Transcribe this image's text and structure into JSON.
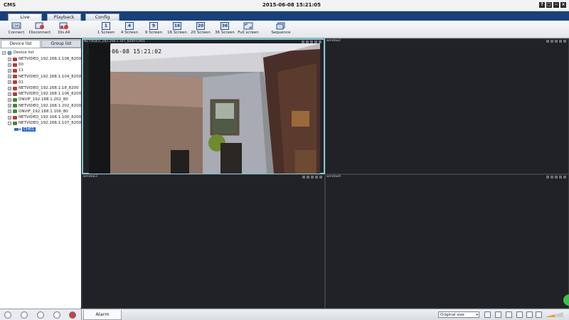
{
  "app": {
    "title": "CMS",
    "datetime": "2015-06-08 15:21:05"
  },
  "window_controls": [
    "?",
    "□",
    "−",
    "×"
  ],
  "main_tabs": [
    "Live",
    "Playback",
    "Config"
  ],
  "toolbar": [
    {
      "label": "Connect",
      "icon": "connect-icon"
    },
    {
      "label": "Disconnect",
      "icon": "disconnect-icon"
    },
    {
      "label": "Dis.All",
      "icon": "disconnect-all-icon"
    },
    {
      "label": "1 Screen",
      "num": "1"
    },
    {
      "label": "4 Screen",
      "num": "4"
    },
    {
      "label": "9 Screen",
      "num": "9"
    },
    {
      "label": "16 Screen",
      "num": "16"
    },
    {
      "label": "20 Screen",
      "num": "20"
    },
    {
      "label": "36 Screen",
      "num": "36"
    },
    {
      "label": "Full screen",
      "icon": "fullscreen-icon"
    },
    {
      "label": "Sequence",
      "icon": "sequence-icon"
    }
  ],
  "left_tabs": [
    "Device list",
    "Group list"
  ],
  "tree": {
    "root": "Device list",
    "devices": [
      {
        "name": "NETVIDEO_192.168.1.108_8200",
        "color": "#b33a3a"
      },
      {
        "name": "00",
        "color": "#b33a3a"
      },
      {
        "name": "11",
        "color": "#b33a3a"
      },
      {
        "name": "NETVIDEO_192.168.1.104_8200",
        "color": "#b33a3a"
      },
      {
        "name": "01",
        "color": "#b33a3a"
      },
      {
        "name": "NETVIDEO_192.168.1.18_8200",
        "color": "#b33a3a"
      },
      {
        "name": "NETVIDEO_192.168.1.106_8200",
        "color": "#b33a3a"
      },
      {
        "name": "ONVIF_192.168.1.202_80",
        "color": "#3a8a3a"
      },
      {
        "name": "NETVIDEO_192.168.1.202_8200",
        "color": "#3a8a3a"
      },
      {
        "name": "ONVIF_192.168.1.106_80",
        "color": "#3a8a3a"
      },
      {
        "name": "NETVIDEO_192.168.1.100_8200",
        "color": "#b33a3a"
      },
      {
        "name": "NETVIDEO_192.168.1.107_8200",
        "color": "#3a8a3a"
      }
    ],
    "selected_channel": "CH01"
  },
  "panes": [
    {
      "title": "NETVIDEO_192.168.1.107_8200-CH01",
      "active": true
    },
    {
      "title": "window2",
      "active": false
    },
    {
      "title": "window3",
      "active": false
    },
    {
      "title": "window4",
      "active": false
    }
  ],
  "camera": {
    "osd_time": "2015-06-08 15:21:02"
  },
  "bottom": {
    "alarm_tab": "Alarm",
    "ratio": "Original size"
  }
}
